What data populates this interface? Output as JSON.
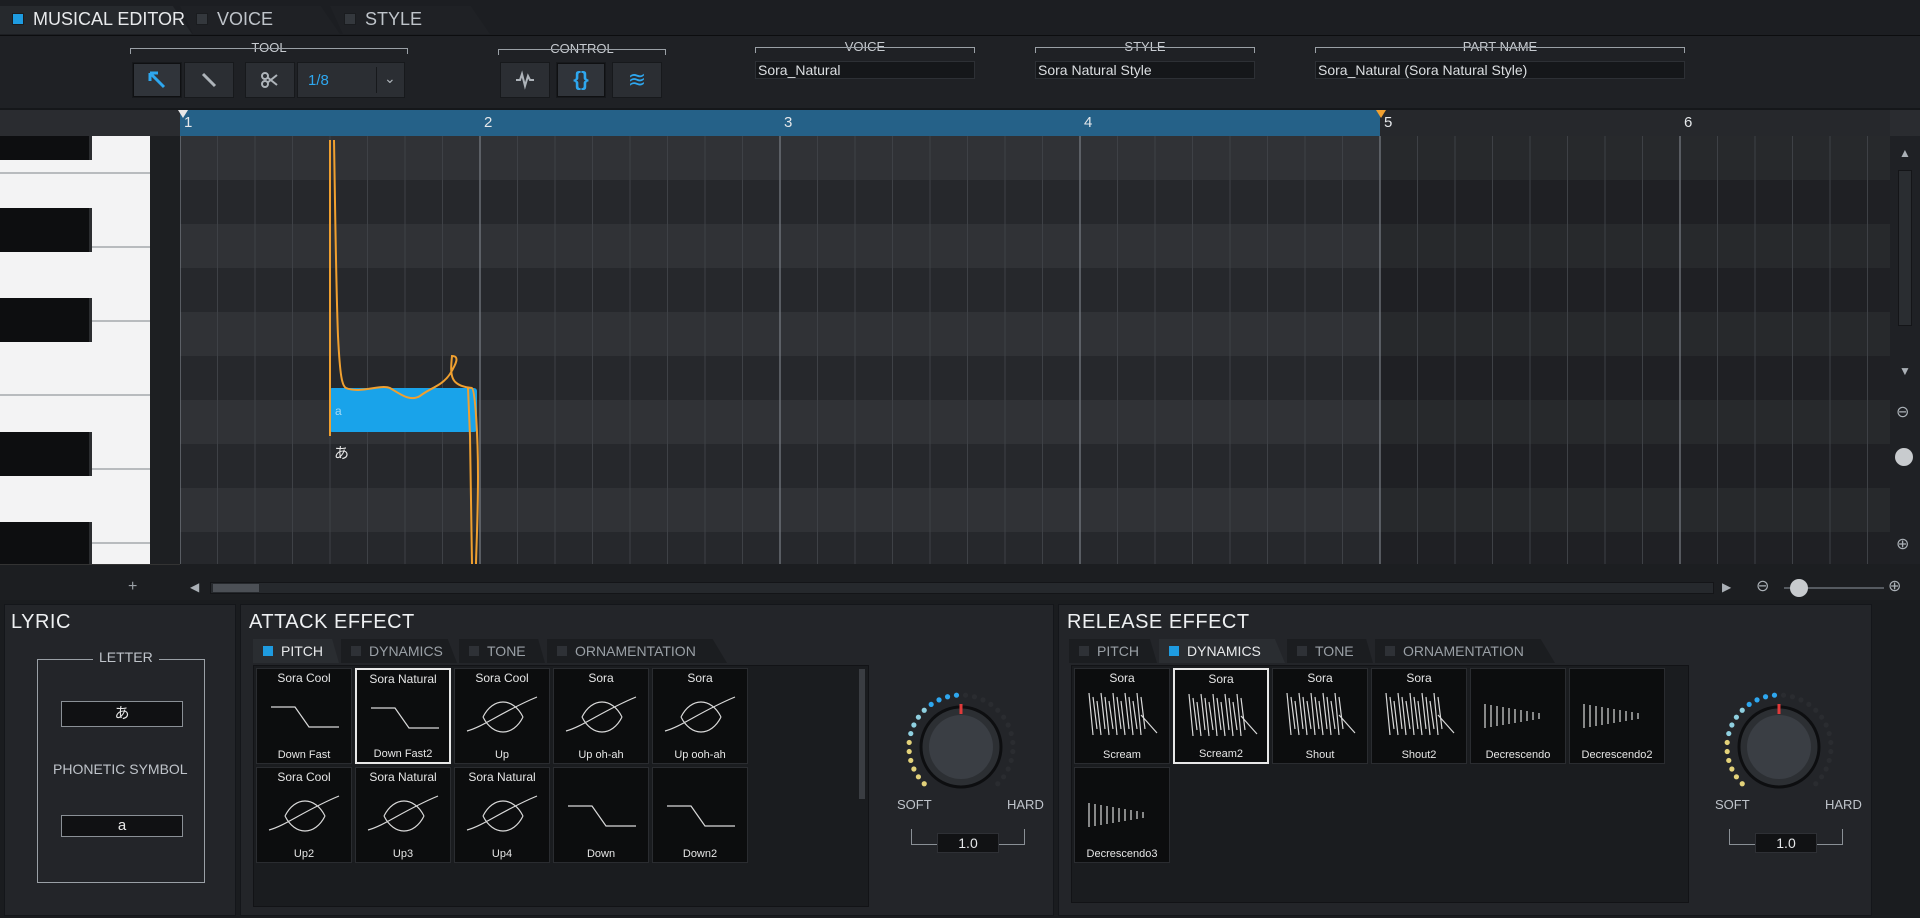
{
  "tabs": [
    {
      "label": "MUSICAL EDITOR",
      "active": true
    },
    {
      "label": "VOICE",
      "active": false
    },
    {
      "label": "STYLE",
      "active": false
    }
  ],
  "toolbar": {
    "tool_label": "TOOL",
    "control_label": "CONTROL",
    "quantize": "1/8",
    "voice_label": "VOICE",
    "voice_value": "Sora_Natural",
    "style_label": "STYLE",
    "style_value": "Sora Natural Style",
    "part_label": "PART NAME",
    "part_value": "Sora_Natural (Sora Natural Style)"
  },
  "ruler": {
    "bars": [
      "1",
      "2",
      "3",
      "4",
      "5",
      "6"
    ]
  },
  "note": {
    "lyric": "あ",
    "phoneme": "a"
  },
  "colors": {
    "accent": "#1e9be0",
    "note": "#19a3ea",
    "pitch_curve": "#f0a030",
    "selection": "#256188"
  },
  "lyric_panel": {
    "title": "LYRIC",
    "letter_label": "LETTER",
    "letter_value": "あ",
    "phonetic_label": "PHONETIC SYMBOL",
    "phonetic_value": "a"
  },
  "attack": {
    "title": "ATTACK EFFECT",
    "tabs": [
      "PITCH",
      "DYNAMICS",
      "TONE",
      "ORNAMENTATION"
    ],
    "active_tab": "PITCH",
    "presets": [
      {
        "top": "Sora Cool",
        "bottom": "Down Fast",
        "selected": false
      },
      {
        "top": "Sora Natural",
        "bottom": "Down Fast2",
        "selected": true
      },
      {
        "top": "Sora Cool",
        "bottom": "Up",
        "selected": false
      },
      {
        "top": "Sora",
        "bottom": "Up oh-ah",
        "selected": false
      },
      {
        "top": "Sora",
        "bottom": "Up ooh-ah",
        "selected": false
      },
      {
        "top": "Sora Cool",
        "bottom": "Up2",
        "selected": false
      },
      {
        "top": "Sora Natural",
        "bottom": "Up3",
        "selected": false
      },
      {
        "top": "Sora Natural",
        "bottom": "Up4",
        "selected": false
      },
      {
        "top": "",
        "bottom": "Down",
        "selected": false
      },
      {
        "top": "",
        "bottom": "Down2",
        "selected": false
      }
    ],
    "soft_label": "SOFT",
    "hard_label": "HARD",
    "value": "1.0"
  },
  "release": {
    "title": "RELEASE EFFECT",
    "tabs": [
      "PITCH",
      "DYNAMICS",
      "TONE",
      "ORNAMENTATION"
    ],
    "active_tab": "DYNAMICS",
    "presets": [
      {
        "top": "Sora",
        "bottom": "Scream",
        "selected": false
      },
      {
        "top": "Sora",
        "bottom": "Scream2",
        "selected": true
      },
      {
        "top": "Sora",
        "bottom": "Shout",
        "selected": false
      },
      {
        "top": "Sora",
        "bottom": "Shout2",
        "selected": false
      },
      {
        "top": "",
        "bottom": "Decrescendo",
        "selected": false
      },
      {
        "top": "",
        "bottom": "Decrescendo2",
        "selected": false
      },
      {
        "top": "",
        "bottom": "Decrescendo3",
        "selected": false
      }
    ],
    "soft_label": "SOFT",
    "hard_label": "HARD",
    "value": "1.0"
  }
}
